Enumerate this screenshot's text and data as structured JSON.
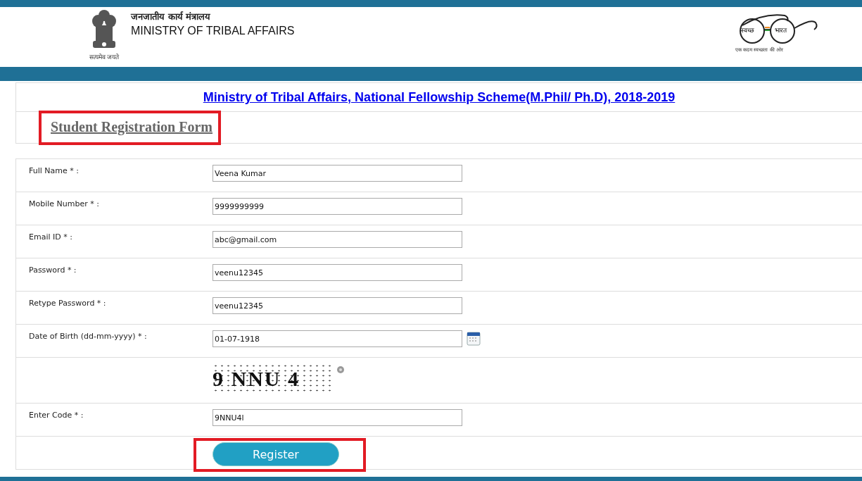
{
  "header": {
    "emblem_motto": "सत्यमेव जयते",
    "ministry_hindi": "जनजातीय कार्य मंत्रालय",
    "ministry_english": "MINISTRY OF TRIBAL AFFAIRS",
    "campaign_logo": {
      "left_word": "स्वच्छ",
      "right_word": "भारत",
      "tagline": "एक कदम स्वच्छता की ओर"
    }
  },
  "scheme_title": "Ministry of Tribal Affairs, National Fellowship Scheme(M.Phil/ Ph.D), 2018-2019",
  "form_heading": {
    "text": "Student Registration Form",
    "highlighted": true
  },
  "form": {
    "rows": [
      {
        "kind": "field",
        "label": "Full Name * :",
        "value": "Veena Kumar"
      },
      {
        "kind": "field",
        "label": "Mobile Number * :",
        "value": "9999999999"
      },
      {
        "kind": "field",
        "label": "Email ID * :",
        "value": "abc@gmail.com"
      },
      {
        "kind": "field",
        "label": "Password * :",
        "value": "veenu12345"
      },
      {
        "kind": "field",
        "label": "Retype Password * :",
        "value": "veenu12345"
      },
      {
        "kind": "date",
        "label": "Date of Birth (dd-mm-yyyy) * :",
        "value": "01-07-1918"
      },
      {
        "kind": "captcha",
        "text": "9 NNU 4"
      },
      {
        "kind": "field",
        "label": "Enter Code *  :",
        "value": "9NNU4l"
      }
    ],
    "submit": {
      "label": "Register",
      "highlighted": true
    }
  }
}
